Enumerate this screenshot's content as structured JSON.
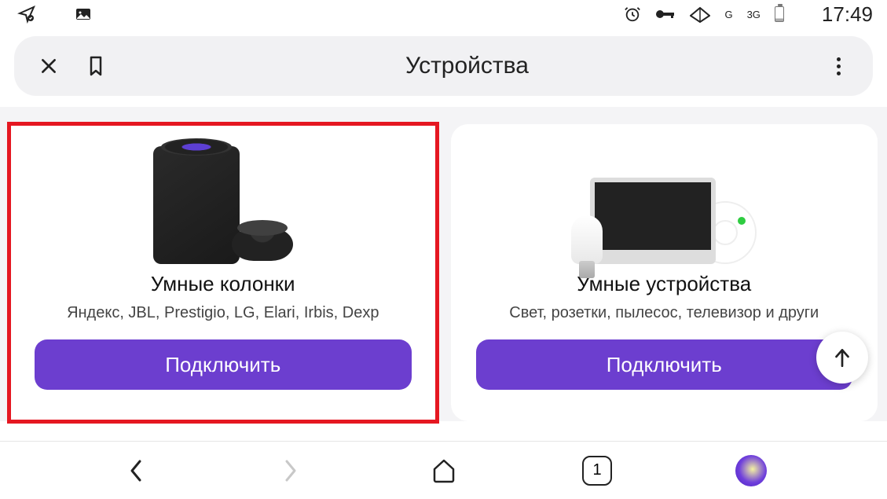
{
  "status_bar": {
    "left_icons": [
      "location-share-icon",
      "image-icon"
    ],
    "right": {
      "signal_label_left": "G",
      "signal_label_right": "3G",
      "clock": "17:49"
    }
  },
  "header": {
    "title": "Устройства"
  },
  "cards": [
    {
      "title": "Умные колонки",
      "subtitle": "Яндекс, JBL, Prestigio, LG, Elari, Irbis, Dexp",
      "button": "Подключить",
      "highlighted": true
    },
    {
      "title": "Умные устройства",
      "subtitle": "Свет, розетки, пылесос, телевизор и други",
      "button": "Подключить",
      "highlighted": false
    }
  ],
  "bottom_nav": {
    "tab_count": "1"
  },
  "accent_color": "#6c3ecf",
  "highlight_color": "#e51721"
}
